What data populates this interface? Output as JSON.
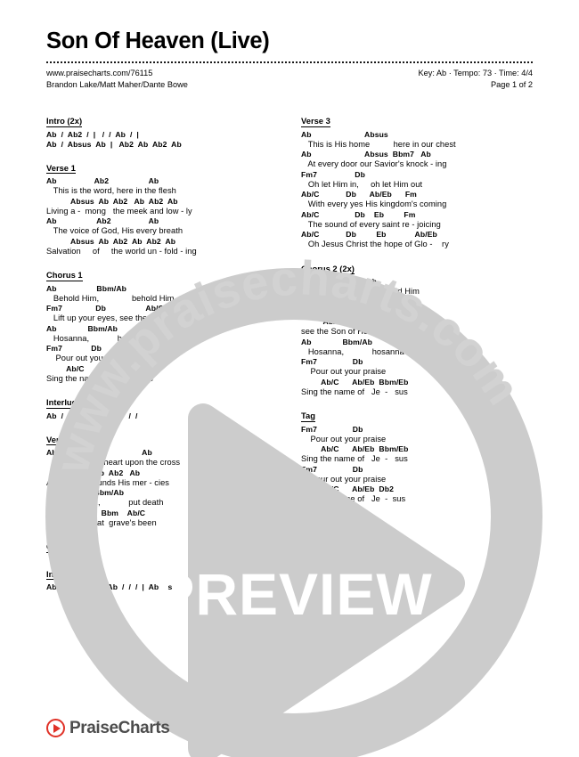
{
  "header": {
    "title": "Son Of Heaven (Live)",
    "url": "www.praisecharts.com/76115",
    "authors": "Brandon Lake/Matt Maher/Dante Bowe",
    "key_tempo_time": "Key: Ab · Tempo: 73 · Time: 4/4",
    "page_number": "Page 1 of 2"
  },
  "watermark": {
    "preview_label": "PREVIEW",
    "arc_text": "www.praisecharts.com",
    "ring_color": "#cccccc",
    "preview_text_color": "#ffffff"
  },
  "footer": {
    "logo_text": "PraiseCharts",
    "logo_color": "#e03127"
  },
  "columns": [
    {
      "name": "left-column",
      "sections": [
        {
          "heading": "Intro (2x)",
          "lines": [
            {
              "type": "chord",
              "text": "Ab  /  Ab2  /  |   /  /  Ab  /  |"
            },
            {
              "type": "chord",
              "text": "Ab  /  Absus  Ab  |   Ab2  Ab  Ab2  Ab"
            }
          ]
        },
        {
          "heading": "Verse 1",
          "lines": [
            {
              "type": "chord",
              "text": "Ab                 Ab2                  Ab"
            },
            {
              "type": "lyric",
              "text": "   This is the word, here in the flesh"
            },
            {
              "type": "chord",
              "text": "           Absus  Ab  Ab2   Ab  Ab2  Ab"
            },
            {
              "type": "lyric",
              "text": "Living a -  mong   the meek and low - ly"
            },
            {
              "type": "chord",
              "text": "Ab                  Ab2                 Ab"
            },
            {
              "type": "lyric",
              "text": "   The voice of God, His every breath"
            },
            {
              "type": "chord",
              "text": "           Absus  Ab  Ab2  Ab  Ab2  Ab"
            },
            {
              "type": "lyric",
              "text": "Salvation     of     the world un - fold - ing"
            }
          ]
        },
        {
          "heading": "Chorus 1",
          "lines": [
            {
              "type": "chord",
              "text": "Ab                  Bbm/Ab"
            },
            {
              "type": "lyric",
              "text": "   Behold Him,              behold Him"
            },
            {
              "type": "chord",
              "text": "Fm7               Db                  Ab/C   Ab/Eb  Eb"
            },
            {
              "type": "lyric",
              "text": "   Lift up your eyes, see the Son of Heav - en"
            },
            {
              "type": "chord",
              "text": "Ab              Bbm/Ab"
            },
            {
              "type": "lyric",
              "text": "   Hosanna,            hosanna"
            },
            {
              "type": "chord",
              "text": "Fm7             Db"
            },
            {
              "type": "lyric",
              "text": "    Pour out your praise"
            },
            {
              "type": "chord",
              "text": "         Ab/C      Ab/Eb  Bbm/Eb"
            },
            {
              "type": "lyric",
              "text": "Sing the name of   Je  -   sus"
            }
          ]
        },
        {
          "heading": "Interlude 1",
          "lines": [
            {
              "type": "chord",
              "text": "Ab  /  /  /  |  Bbm/Ab  /  /  /"
            }
          ]
        },
        {
          "heading": "Verse 2",
          "lines": [
            {
              "type": "chord",
              "text": "Ab                Ab2                Ab"
            },
            {
              "type": "lyric",
              "text": "   He wrote His heart upon the cross"
            },
            {
              "type": "chord",
              "text": "         Absus  Ab  Ab2   Ab"
            },
            {
              "type": "lyric",
              "text": "And in His wounds His mer - cies"
            },
            {
              "type": "chord",
              "text": "          Ab2     Bbm/Ab"
            },
            {
              "type": "lyric",
              "text": "Like the dawn,            put death"
            },
            {
              "type": "chord",
              "text": "      Db    Ab/C  Bbm    Ab/C"
            },
            {
              "type": "lyric",
              "text": "Ever since  that  grave's been"
            }
          ]
        },
        {
          "heading": "Chorus 1 (2x)",
          "lines": []
        },
        {
          "heading": "Instrumental 1",
          "lines": [
            {
              "type": "chord",
              "text": "Ab  /  /  /  |  Bbm/Ab  /  /  /  |  Absus"
            }
          ]
        }
      ]
    },
    {
      "name": "right-column",
      "sections": [
        {
          "heading": "Verse 3",
          "lines": [
            {
              "type": "chord",
              "text": "Ab                        Absus"
            },
            {
              "type": "lyric",
              "text": "   This is His home          here in our chest"
            },
            {
              "type": "chord",
              "text": "Ab                        Absus  Bbm7   Ab"
            },
            {
              "type": "lyric",
              "text": "   At every door our Savior's knock - ing"
            },
            {
              "type": "chord",
              "text": "Fm7                 Db"
            },
            {
              "type": "lyric",
              "text": "   Oh let Him in,     oh let Him out"
            },
            {
              "type": "chord",
              "text": "Ab/C            Db      Ab/Eb      Fm"
            },
            {
              "type": "lyric",
              "text": "   With every yes His kingdom's coming"
            },
            {
              "type": "chord",
              "text": "Ab/C                Db    Eb         Fm"
            },
            {
              "type": "lyric",
              "text": "   The sound of every saint re - joicing"
            },
            {
              "type": "chord",
              "text": "Ab/C            Db         Eb             Ab/Eb"
            },
            {
              "type": "lyric",
              "text": "   Oh Jesus Christ the hope of Glo -    ry"
            }
          ]
        },
        {
          "heading": "Chorus 2 (2x)",
          "lines": [
            {
              "type": "chord",
              "text": "Ab                Bbm/Ab"
            },
            {
              "type": "lyric",
              "text": "   Behold Him,          behold Him"
            },
            {
              "type": "chord",
              "text": "Fm7             Db"
            },
            {
              "type": "lyric",
              "text": "   Lift up your eyes"
            },
            {
              "type": "chord",
              "text": "          Ab/C   Ab/Eb  Bbm/Eb"
            },
            {
              "type": "lyric",
              "text": "see the Son of Heav -   en"
            },
            {
              "type": "chord",
              "text": "Ab              Bbm/Ab"
            },
            {
              "type": "lyric",
              "text": "   Hosanna,            hosanna"
            },
            {
              "type": "chord",
              "text": "Fm7                Db"
            },
            {
              "type": "lyric",
              "text": "    Pour out your praise"
            },
            {
              "type": "chord",
              "text": "         Ab/C      Ab/Eb  Bbm/Eb"
            },
            {
              "type": "lyric",
              "text": "Sing the name of   Je  -   sus"
            }
          ]
        },
        {
          "heading": "Tag",
          "lines": [
            {
              "type": "chord",
              "text": "Fm7                Db"
            },
            {
              "type": "lyric",
              "text": "    Pour out your praise"
            },
            {
              "type": "chord",
              "text": "         Ab/C      Ab/Eb  Bbm/Eb"
            },
            {
              "type": "lyric",
              "text": "Sing the name of   Je  -   sus"
            },
            {
              "type": "chord",
              "text": "Fm7                Db"
            },
            {
              "type": "lyric",
              "text": "    Pour out your praise"
            },
            {
              "type": "chord",
              "text": "         Ab/C      Ab/Eb  Db2"
            },
            {
              "type": "lyric",
              "text": "Sing the name of   Je  -  sus"
            }
          ]
        }
      ]
    }
  ]
}
